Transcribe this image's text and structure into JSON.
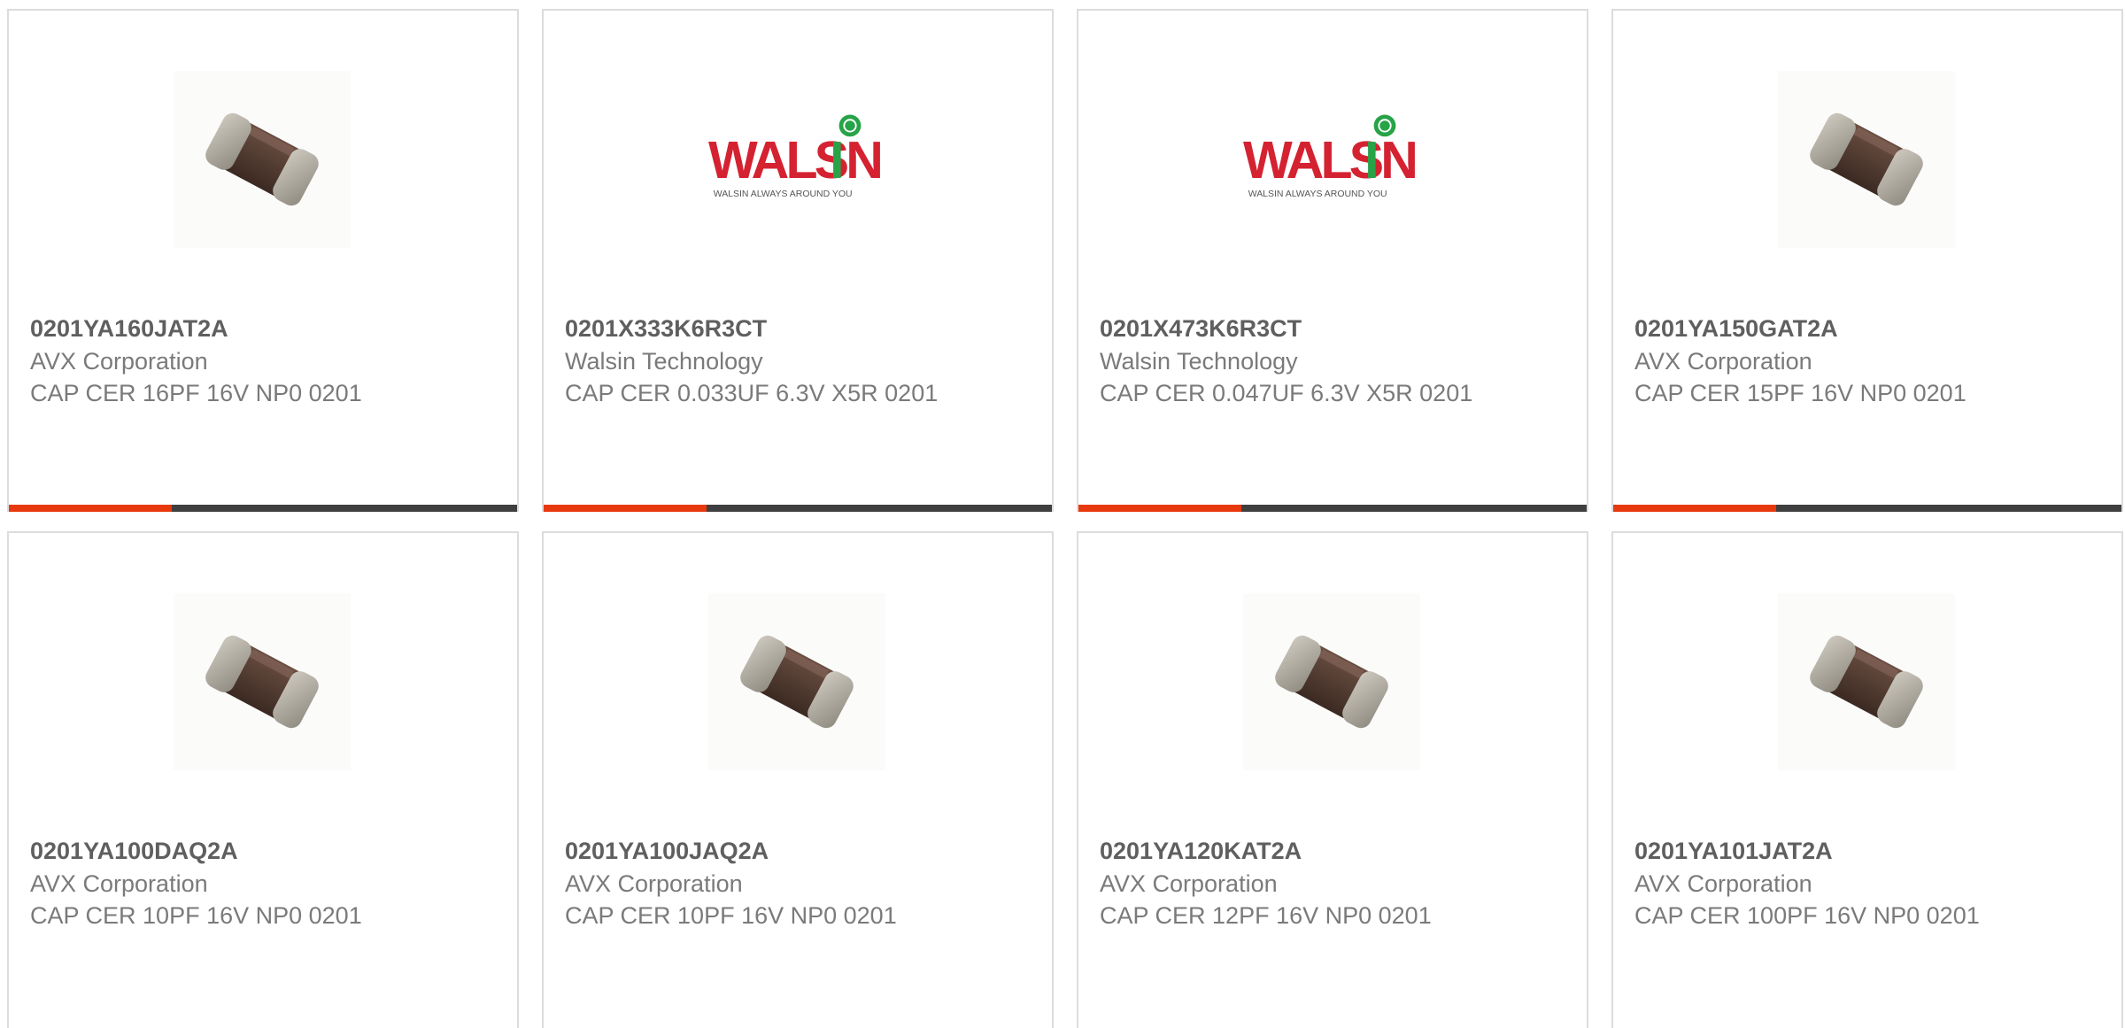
{
  "colors": {
    "accent": "#e8380d",
    "bar_track": "#3f3f3f",
    "text_title": "#5f5f5f",
    "text_body": "#7a7a7a",
    "card_border": "#dcdcdc"
  },
  "products": [
    {
      "part_number": "0201YA160JAT2A",
      "manufacturer": "AVX Corporation",
      "description": "CAP CER 16PF 16V NP0 0201",
      "image": "ceramic-capacitor-chip",
      "progress": 0.32
    },
    {
      "part_number": "0201X333K6R3CT",
      "manufacturer": "Walsin Technology",
      "description": "CAP CER 0.033UF 6.3V X5R 0201",
      "image": "walsin-logo",
      "progress": 0.32
    },
    {
      "part_number": "0201X473K6R3CT",
      "manufacturer": "Walsin Technology",
      "description": "CAP CER 0.047UF 6.3V X5R 0201",
      "image": "walsin-logo",
      "progress": 0.32
    },
    {
      "part_number": "0201YA150GAT2A",
      "manufacturer": "AVX Corporation",
      "description": "CAP CER 15PF 16V NP0 0201",
      "image": "ceramic-capacitor-chip",
      "progress": 0.32
    },
    {
      "part_number": "0201YA100DAQ2A",
      "manufacturer": "AVX Corporation",
      "description": "CAP CER 10PF 16V NP0 0201",
      "image": "ceramic-capacitor-chip"
    },
    {
      "part_number": "0201YA100JAQ2A",
      "manufacturer": "AVX Corporation",
      "description": "CAP CER 10PF 16V NP0 0201",
      "image": "ceramic-capacitor-chip"
    },
    {
      "part_number": "0201YA120KAT2A",
      "manufacturer": "AVX Corporation",
      "description": "CAP CER 12PF 16V NP0 0201",
      "image": "ceramic-capacitor-chip"
    },
    {
      "part_number": "0201YA101JAT2A",
      "manufacturer": "AVX Corporation",
      "description": "CAP CER 100PF 16V NP0 0201",
      "image": "ceramic-capacitor-chip"
    }
  ],
  "walsin_logo": {
    "wordmark": "WALSIN",
    "tagline": "WALSIN ALWAYS AROUND YOU"
  }
}
